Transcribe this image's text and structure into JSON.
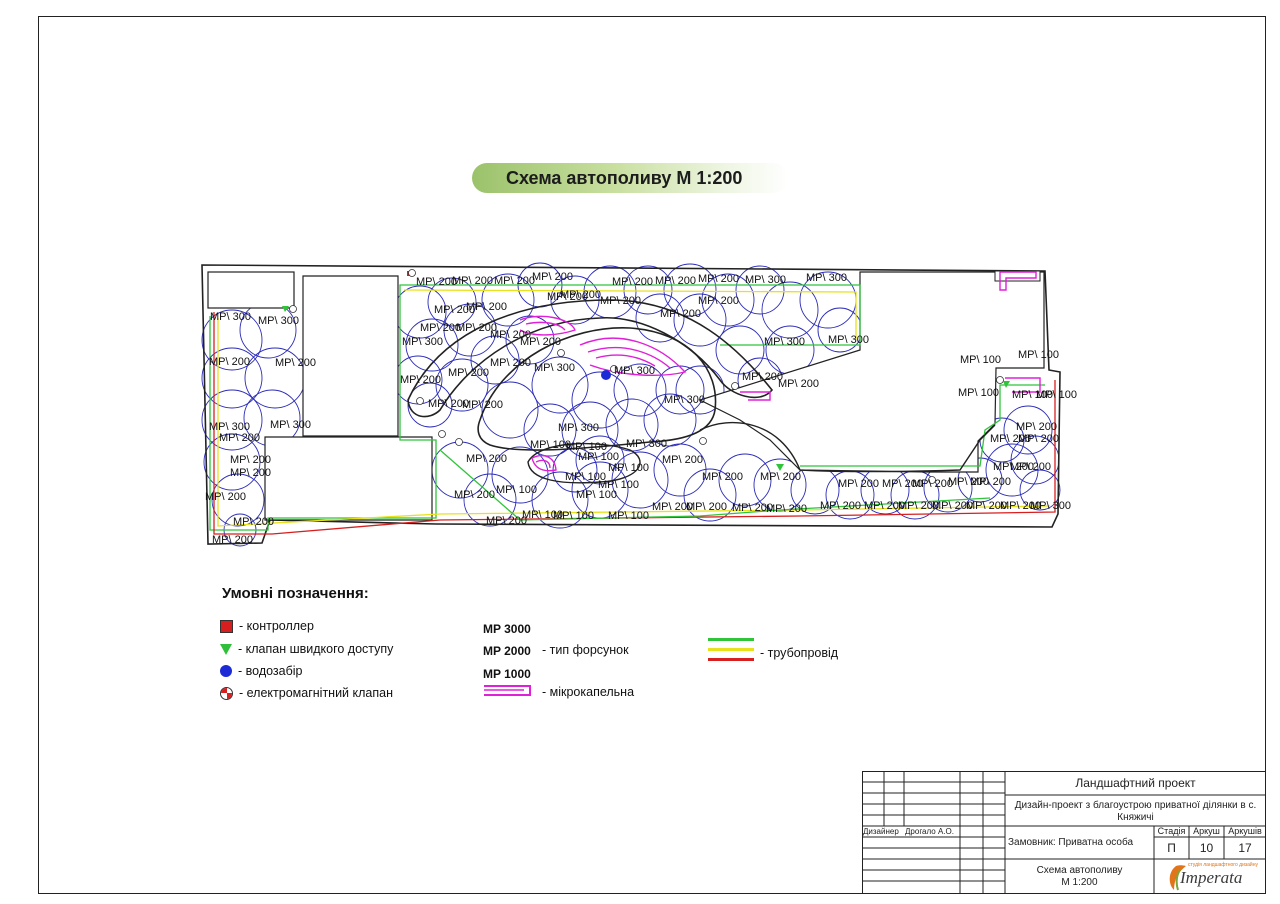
{
  "title": "Схема автополиву  М 1:200",
  "plan_labels": {
    "mp300": "MP\\ 300",
    "mp200": "MP\\ 200",
    "mp100": "MP\\ 100"
  },
  "legend": {
    "heading": "Умовні позначення:",
    "controller": "- контроллер",
    "quick_valve": "- клапан швидкого доступу",
    "water_intake": "- водозабір",
    "solenoid_valve": "- електромагнітний клапан",
    "mp3000": "MP 3000",
    "mp2000": "MP 2000",
    "mp1000": "MP 1000",
    "nozzle_type": "- тип форсунок",
    "micro_drip": "- мікрокапельна",
    "pipeline": "- трубопровід"
  },
  "colors": {
    "circle": "#2b2bb8",
    "pipe_green": "#2fc43a",
    "pipe_yellow": "#e8e21c",
    "pipe_red": "#d71f1f",
    "drip": "#e020d8",
    "title_green": "#9bc26b"
  },
  "stamp": {
    "project": "Ландшафтний проект",
    "description": "Дизайн-проект з благоустрою приватної ділянки в с. Княжичі",
    "designer_role": "Дизайнер",
    "designer_name": "Дрогало А.О.",
    "client": "Замовник: Приватна особа",
    "stage_label": "Стадія",
    "sheet_label": "Аркуш",
    "sheets_label": "Аркушів",
    "stage": "П",
    "sheet": "10",
    "sheets": "17",
    "drawing_title": "Схема автополиву",
    "scale": "М 1:200",
    "logo_name": "Imperata",
    "logo_tagline": "студія ландшафтного дизайну"
  }
}
